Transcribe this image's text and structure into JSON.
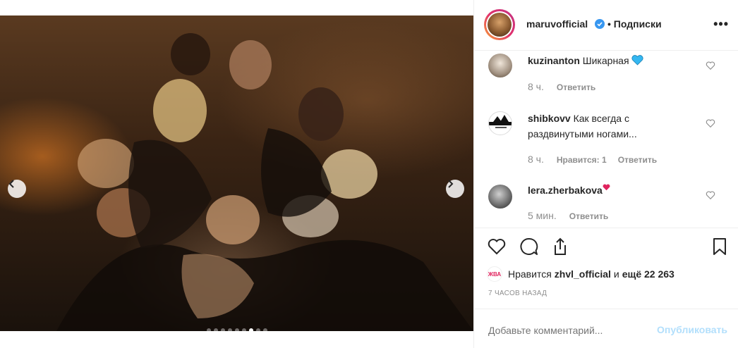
{
  "post": {
    "author": "maruvofficial",
    "follow_status": "• Подписки",
    "more_icon": "more-horizontal-icon",
    "image_dots_total": 9,
    "image_dots_active": 7
  },
  "comments": [
    {
      "user": "kuzinanton",
      "text": "Шикарная",
      "emoji": "blue-heart",
      "time": "8 ч.",
      "likes_text": "",
      "reply": "Ответить"
    },
    {
      "user": "shibkovv",
      "text": "Как всегда с раздвинутыми ногами...",
      "emoji": "",
      "time": "8 ч.",
      "likes_text": "Нравится: 1",
      "reply": "Ответить"
    },
    {
      "user": "lera.zherbakova",
      "text": "",
      "emoji": "red-heart",
      "time": "5 мин.",
      "likes_text": "",
      "reply": "Ответить"
    }
  ],
  "likes": {
    "prefix": "Нравится",
    "user": "zhvl_official",
    "and": "и",
    "rest": "ещё 22 263",
    "avatar_label": "ЖВА"
  },
  "timestamp": "7 ЧАСОВ НАЗАД",
  "add_comment": {
    "placeholder": "Добавьте комментарий...",
    "publish": "Опубликовать"
  },
  "colors": {
    "verified": "#3897f0",
    "publish_disabled": "#b2dffc",
    "text": "#262626",
    "muted": "#8e8e8e"
  }
}
